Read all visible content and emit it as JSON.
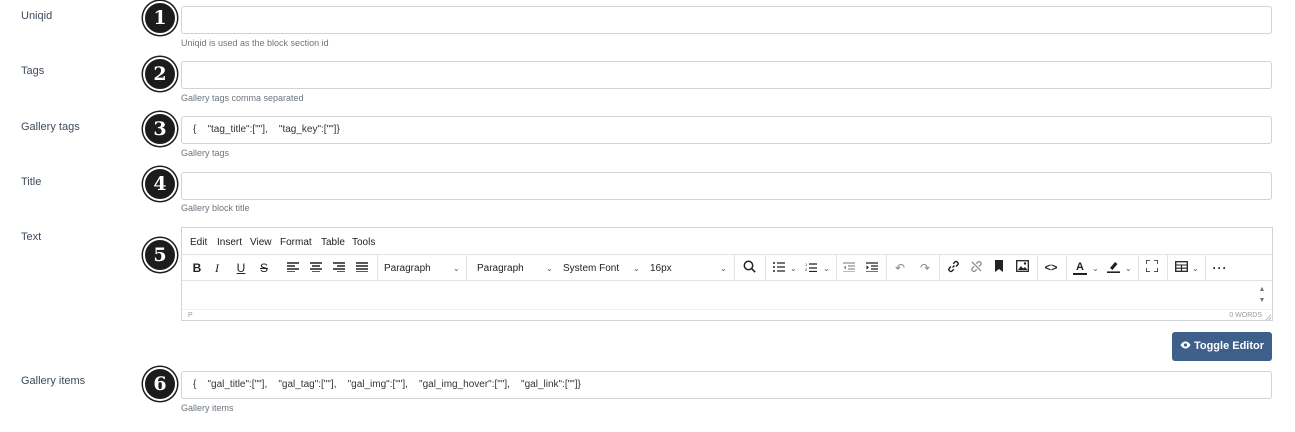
{
  "fields": {
    "uniqid": {
      "label": "Uniqid",
      "value": "",
      "hint": "Uniqid is used as the block section id",
      "badge": "1"
    },
    "tags": {
      "label": "Tags",
      "value": "",
      "hint": "Gallery tags comma separated",
      "badge": "2"
    },
    "gallery_tags": {
      "label": "Gallery tags",
      "value": "{    \"tag_title\":[\"\"],    \"tag_key\":[\"\"]}",
      "hint": "Gallery tags",
      "badge": "3"
    },
    "title": {
      "label": "Title",
      "value": "",
      "hint": "Gallery block title",
      "badge": "4"
    },
    "text": {
      "label": "Text",
      "badge": "5"
    },
    "gallery_items": {
      "label": "Gallery items",
      "value": "{    \"gal_title\":[\"\"],    \"gal_tag\":[\"\"],    \"gal_img\":[\"\"],    \"gal_img_hover\":[\"\"],    \"gal_link\":[\"\"]}",
      "hint": "Gallery items",
      "badge": "6"
    }
  },
  "editor": {
    "menu": [
      "Edit",
      "Insert",
      "View",
      "Format",
      "Table",
      "Tools"
    ],
    "block_format_1": "Paragraph",
    "block_format_2": "Paragraph",
    "font_family": "System Font",
    "font_size": "16px",
    "status_path": "P",
    "word_count": "0 WORDS"
  },
  "toggle_editor_label": "Toggle Editor"
}
